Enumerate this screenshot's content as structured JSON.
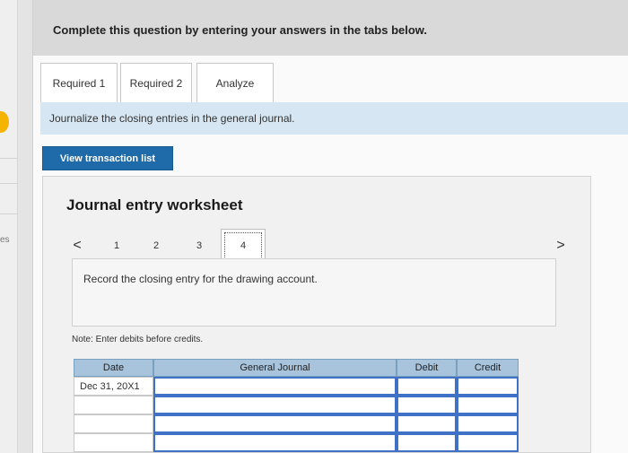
{
  "header": {
    "text": "Complete this question by entering your answers in the tabs below."
  },
  "tabs": [
    {
      "label": "Required 1"
    },
    {
      "label": "Required 2"
    },
    {
      "label": "Analyze"
    }
  ],
  "instruction": "Journalize the closing entries in the general journal.",
  "view_button": "View transaction list",
  "worksheet": {
    "title": "Journal entry worksheet",
    "pager": {
      "prev": "<",
      "pages": [
        "1",
        "2",
        "3",
        "4"
      ],
      "current": "4",
      "next": ">"
    },
    "record_text": "Record the closing entry for the drawing account.",
    "note": "Note: Enter debits before credits.",
    "table": {
      "headers": {
        "date": "Date",
        "general_journal": "General Journal",
        "debit": "Debit",
        "credit": "Credit"
      },
      "rows": [
        {
          "date": "Dec 31, 20X1",
          "general_journal": "",
          "debit": "",
          "credit": ""
        },
        {
          "date": "",
          "general_journal": "",
          "debit": "",
          "credit": ""
        },
        {
          "date": "",
          "general_journal": "",
          "debit": "",
          "credit": ""
        },
        {
          "date": "",
          "general_journal": "",
          "debit": "",
          "credit": ""
        }
      ]
    }
  },
  "left_fragment": "es"
}
